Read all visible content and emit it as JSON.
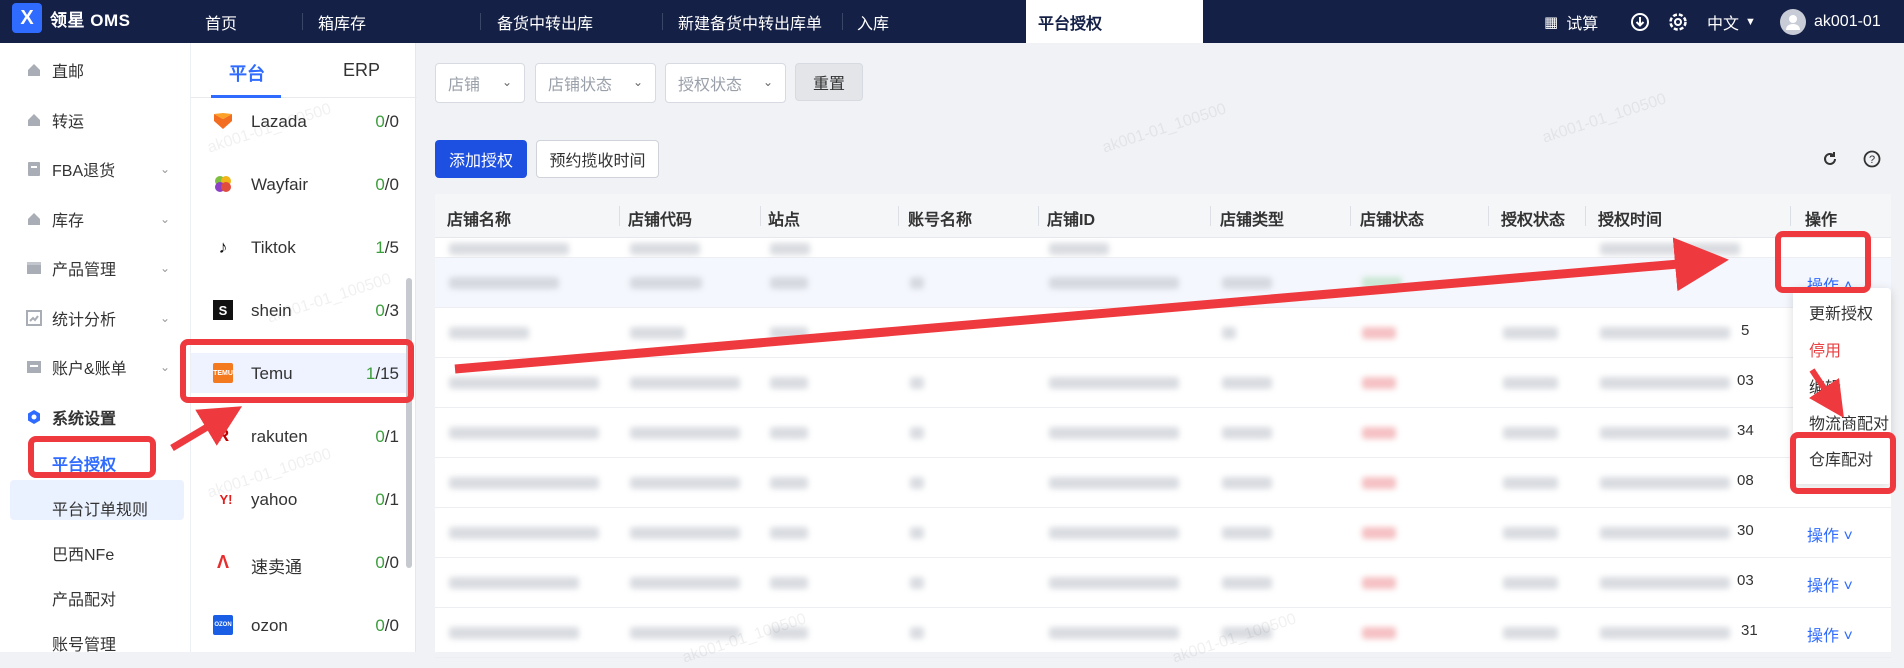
{
  "topbar": {
    "logo_mark": "X",
    "app_name": "领星 OMS",
    "tabs": [
      {
        "label": "首页"
      },
      {
        "label": "箱库存"
      },
      {
        "label": "备货中转出库"
      },
      {
        "label": "新建备货中转出库单"
      },
      {
        "label": "入库"
      },
      {
        "label": "平台授权"
      }
    ],
    "trial_label": "试算",
    "language": "中文",
    "user": "ak001-01"
  },
  "sidebar": {
    "items": [
      {
        "label": "直邮",
        "icon": "home-icon"
      },
      {
        "label": "转运",
        "icon": "home-icon"
      },
      {
        "label": "FBA退货",
        "icon": "document-icon"
      },
      {
        "label": "库存",
        "icon": "home-icon"
      },
      {
        "label": "产品管理",
        "icon": "box-icon"
      },
      {
        "label": "统计分析",
        "icon": "chart-icon"
      },
      {
        "label": "账户&账单",
        "icon": "ledger-icon"
      },
      {
        "label": "系统设置",
        "icon": "settings-icon"
      }
    ],
    "sub_items": [
      {
        "label": "平台授权"
      },
      {
        "label": "平台订单规则"
      },
      {
        "label": "巴西NFe"
      },
      {
        "label": "产品配对"
      },
      {
        "label": "账号管理"
      }
    ]
  },
  "platforms": {
    "tabs": [
      "平台",
      "ERP"
    ],
    "list": [
      {
        "name": "Lazada",
        "count": "0",
        "total": "0"
      },
      {
        "name": "Wayfair",
        "count": "0",
        "total": "0"
      },
      {
        "name": "Tiktok",
        "count": "1",
        "total": "5"
      },
      {
        "name": "shein",
        "count": "0",
        "total": "3"
      },
      {
        "name": "Temu",
        "count": "1",
        "total": "15"
      },
      {
        "name": "rakuten",
        "count": "0",
        "total": "1"
      },
      {
        "name": "yahoo",
        "count": "0",
        "total": "1"
      },
      {
        "name": "速卖通",
        "count": "0",
        "total": "0"
      },
      {
        "name": "ozon",
        "count": "0",
        "total": "0"
      }
    ]
  },
  "filters": {
    "shop": "店铺",
    "shop_status": "店铺状态",
    "auth_status": "授权状态",
    "reset": "重置"
  },
  "actions": {
    "add_auth": "添加授权",
    "schedule": "预约揽收时间"
  },
  "table": {
    "columns": [
      "店铺名称",
      "店铺代码",
      "站点",
      "账号名称",
      "店铺ID",
      "店铺类型",
      "店铺状态",
      "授权状态",
      "授权时间",
      "操作"
    ],
    "op_label": "操作",
    "edge_values": [
      "5",
      "03",
      "34",
      "08",
      "30",
      "03",
      "31"
    ]
  },
  "dropdown": {
    "items": [
      "更新授权",
      "停用",
      "编辑",
      "物流商配对",
      "仓库配对"
    ]
  },
  "watermark": "ak001-01_100500"
}
